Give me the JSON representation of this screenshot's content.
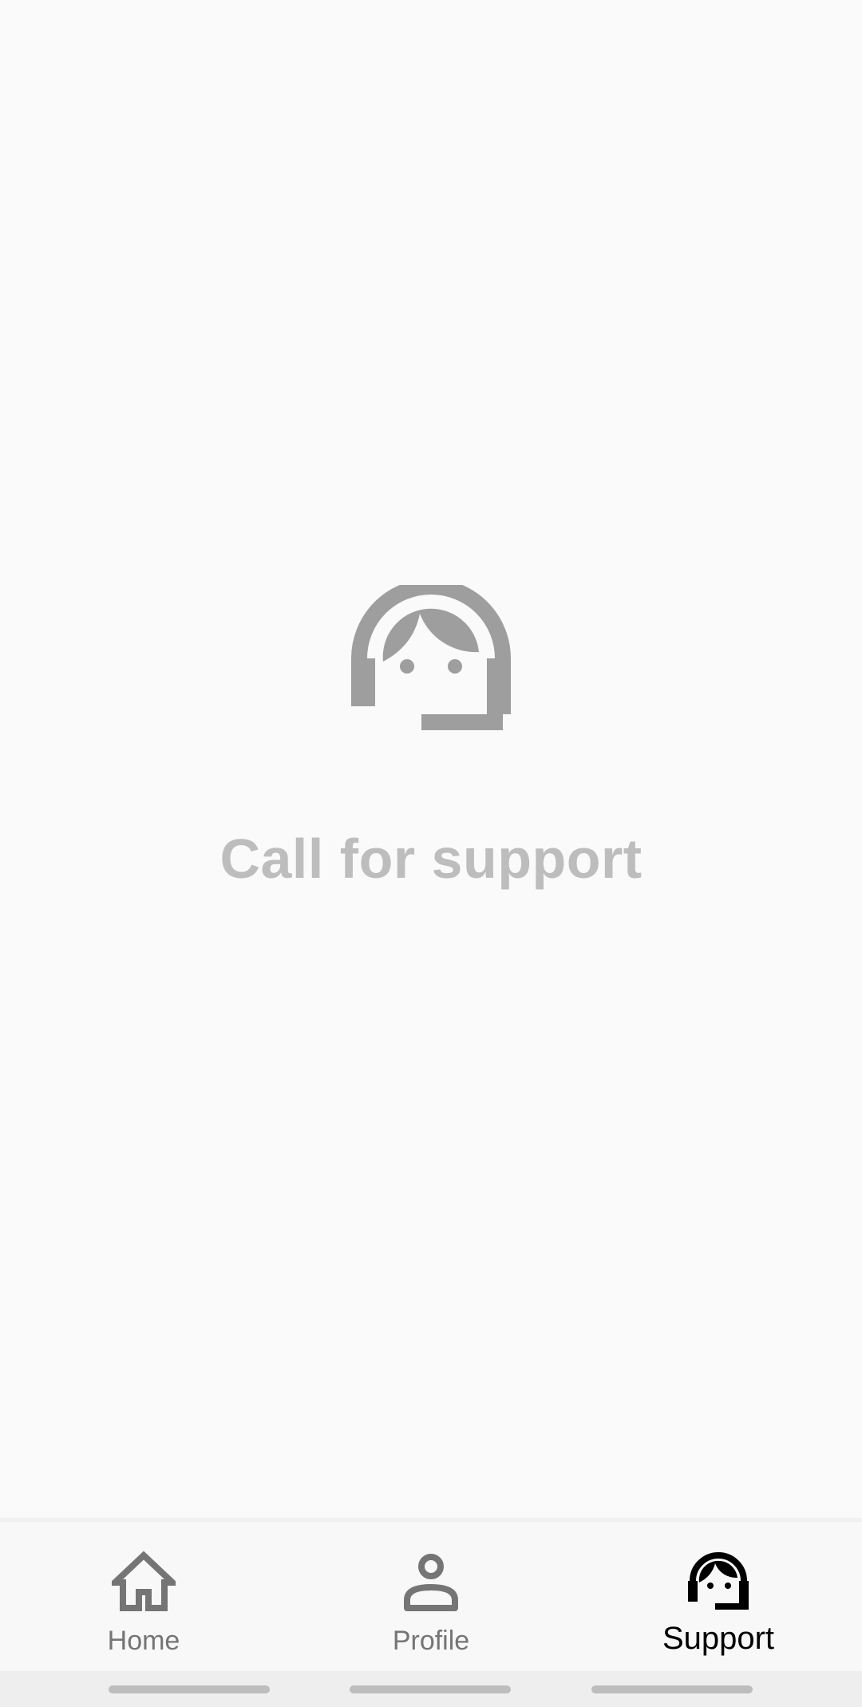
{
  "main": {
    "illustration_icon": "support-agent-icon",
    "title": "Call for support"
  },
  "bottom_nav": {
    "items": [
      {
        "label": "Home",
        "icon": "home-icon",
        "active": false
      },
      {
        "label": "Profile",
        "icon": "person-icon",
        "active": false
      },
      {
        "label": "Support",
        "icon": "support-agent-icon",
        "active": true
      }
    ]
  },
  "colors": {
    "background": "#fafafa",
    "illustration": "#9e9e9e",
    "title": "#bdbdbd",
    "nav_inactive": "#757575",
    "nav_active": "#000000"
  }
}
